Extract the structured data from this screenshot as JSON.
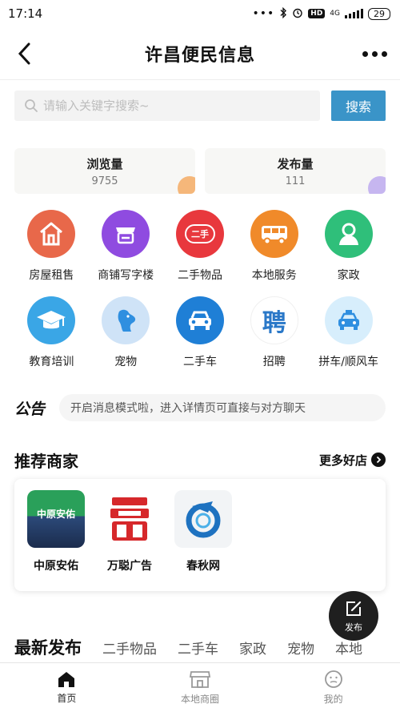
{
  "status_bar": {
    "time": "17:14",
    "hd": "HD",
    "network": "4G",
    "battery": "29"
  },
  "header": {
    "title": "许昌便民信息"
  },
  "search": {
    "placeholder": "请输入关键字搜索~",
    "button_label": "搜索"
  },
  "stats": [
    {
      "label": "浏览量",
      "value": "9755",
      "corner_color": "#f5b77a"
    },
    {
      "label": "发布量",
      "value": "111",
      "corner_color": "#c6b6f0"
    }
  ],
  "categories": [
    {
      "label": "房屋租售",
      "icon": "house-icon",
      "color": "#e8684a"
    },
    {
      "label": "商铺写字楼",
      "icon": "shop-icon",
      "color": "#8f4be0"
    },
    {
      "label": "二手物品",
      "icon": "secondhand-icon",
      "color": "#e8383d",
      "text": "二手"
    },
    {
      "label": "本地服务",
      "icon": "truck-icon",
      "color": "#f08a2a"
    },
    {
      "label": "家政",
      "icon": "housekeeper-icon",
      "color": "#2fbf7a"
    },
    {
      "label": "教育培训",
      "icon": "graduation-cap-icon",
      "color": "#3aa6e6"
    },
    {
      "label": "宠物",
      "icon": "dog-icon",
      "color": "#cfe3f7"
    },
    {
      "label": "二手车",
      "icon": "car-icon",
      "color": "#1f7fd6"
    },
    {
      "label": "招聘",
      "icon": "recruit-icon",
      "color": "#ffffff",
      "text": "聘"
    },
    {
      "label": "拼车/顺风车",
      "icon": "taxi-icon",
      "color": "#d7eefc"
    }
  ],
  "notice": {
    "tag": "公告",
    "text": "开启消息模式啦，进入详情页可直接与对方聊天"
  },
  "merchants_section": {
    "title": "推荐商家",
    "more_label": "更多好店",
    "items": [
      {
        "name": "中原安佑",
        "logo_text": "中原安佑"
      },
      {
        "name": "万聪广告",
        "logo_text": ""
      },
      {
        "name": "春秋网",
        "logo_text": ""
      }
    ]
  },
  "post_button": {
    "label": "发布"
  },
  "latest": {
    "title": "最新发布",
    "tabs": [
      "二手物品",
      "二手车",
      "家政",
      "宠物",
      "本地"
    ]
  },
  "bottom_nav": [
    {
      "label": "首页",
      "icon": "home-icon",
      "active": true
    },
    {
      "label": "本地商圈",
      "icon": "store-icon",
      "active": false
    },
    {
      "label": "我的",
      "icon": "profile-icon",
      "active": false
    }
  ]
}
